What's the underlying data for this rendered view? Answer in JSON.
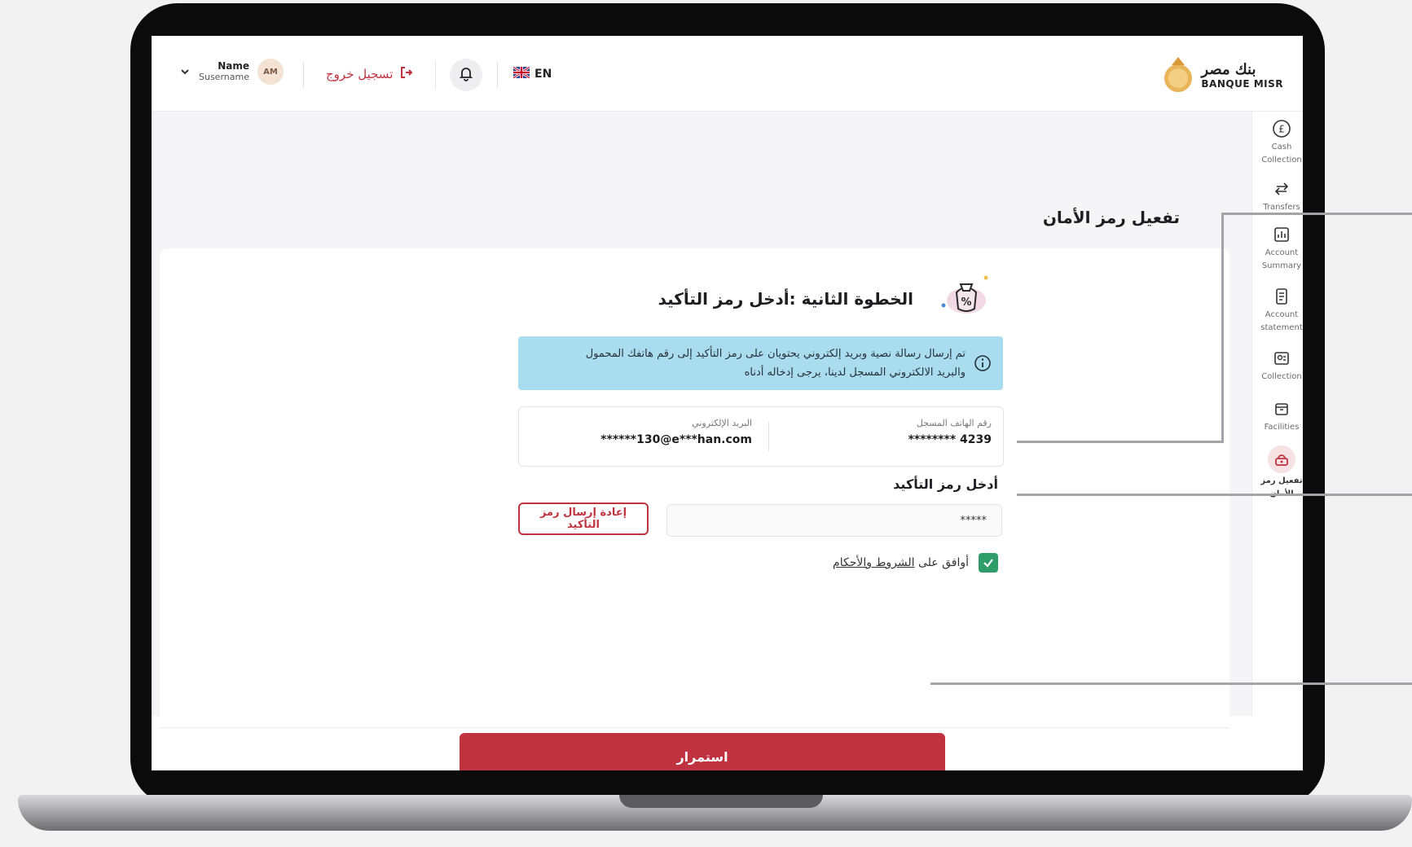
{
  "header": {
    "user_name": "Name",
    "user_surname": "Susername",
    "avatar_initials": "AM",
    "logout_label": "تسجيل خروج",
    "language": "EN",
    "brand_arabic": "بنك مصر",
    "brand_english": "BANQUE MISR"
  },
  "sidebar": {
    "items": [
      {
        "label1": "Cash",
        "label2": "Collection",
        "icon": "pound-coin-icon"
      },
      {
        "label1": "Transfers",
        "label2": "",
        "icon": "transfer-arrows-icon"
      },
      {
        "label1": "Account",
        "label2": "Summary",
        "icon": "chart-icon"
      },
      {
        "label1": "Account",
        "label2": "statement",
        "icon": "document-icon"
      },
      {
        "label1": "Collection",
        "label2": "",
        "icon": "collection-icon"
      },
      {
        "label1": "Facilities",
        "label2": "",
        "icon": "box-icon"
      },
      {
        "label1": "تفعيل رمز",
        "label2": "الأمان",
        "icon": "security-token-icon"
      }
    ]
  },
  "page": {
    "title": "تفعيل رمز الأمان",
    "step_title": "الخطوة الثانية :أدخل رمز التأكيد",
    "info_line1": "تم إرسال رسالة نصية وبريد إلكتروني يحتويان على رمز التأكيد إلى رقم هاتفك المحمول",
    "info_line2": "والبريد الالكتروني المسجل لدينا، يرجى إدخاله أدناه",
    "phone_label": "رقم الهاتف المسجل",
    "phone_value": "******** 4239",
    "email_label": "البريد الإلكتروني",
    "email_value": "******130@e***han.com",
    "otp_label": "أدخل رمز التأكيد",
    "otp_value": "*****",
    "resend_label": "إعادة إرسال رمز التأكيد",
    "terms_prefix": "أوافق على ",
    "terms_link": "الشروط والأحكام",
    "terms_checked": true,
    "continue_label": "استمرار"
  },
  "colors": {
    "brand_red": "#c0323f",
    "info_blue": "#a9dcef",
    "check_green": "#2e9d6a"
  }
}
